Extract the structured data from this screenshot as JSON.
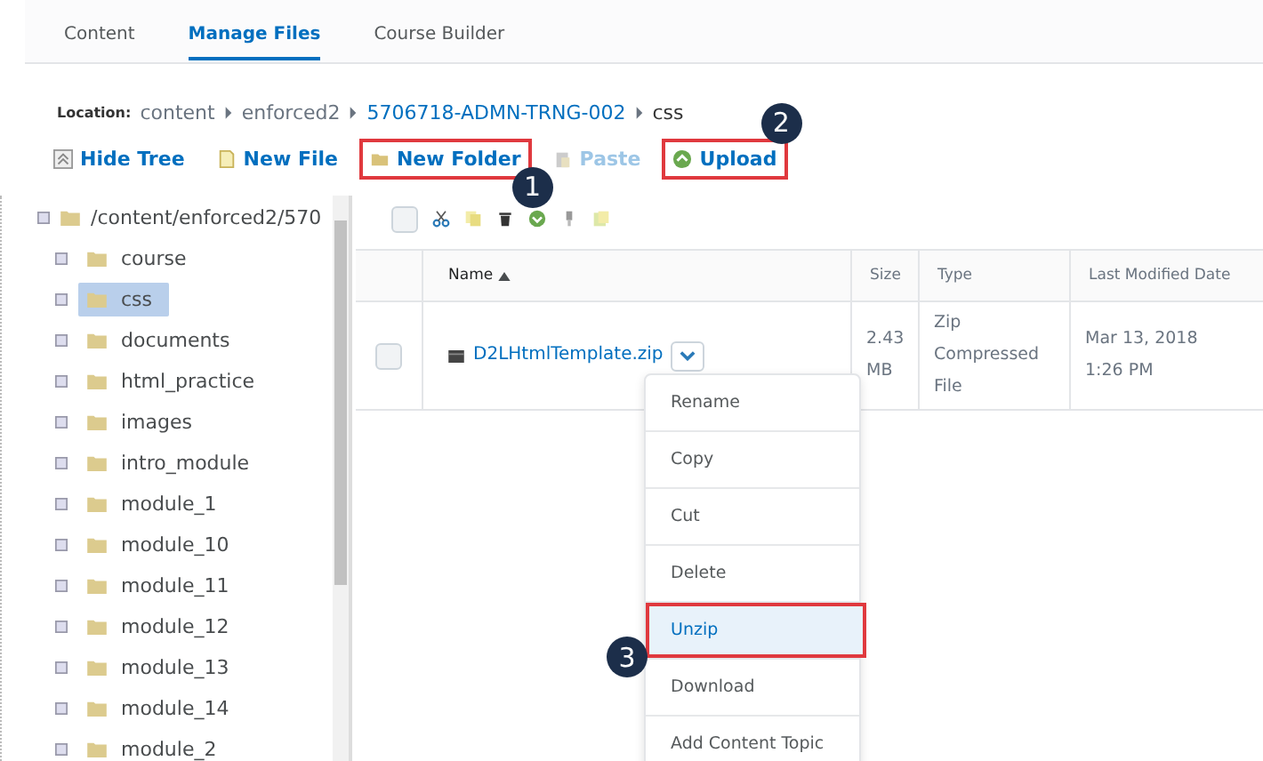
{
  "tabs": [
    {
      "label": "Content",
      "selected": false
    },
    {
      "label": "Manage Files",
      "selected": true
    },
    {
      "label": "Course Builder",
      "selected": false
    }
  ],
  "location": {
    "label": "Location:",
    "crumbs": [
      {
        "text": "content",
        "kind": "plain"
      },
      {
        "text": "enforced2",
        "kind": "plain"
      },
      {
        "text": "5706718-ADMN-TRNG-002",
        "kind": "link"
      },
      {
        "text": "css",
        "kind": "current"
      }
    ]
  },
  "toolbar": [
    {
      "label": "Hide Tree",
      "kind": "hide-tree",
      "disabled": false,
      "highlighted": false
    },
    {
      "label": "New File",
      "kind": "new-file",
      "disabled": false,
      "highlighted": false
    },
    {
      "label": "New Folder",
      "kind": "new-folder",
      "disabled": false,
      "highlighted": true,
      "callout": "1"
    },
    {
      "label": "Paste",
      "kind": "paste",
      "disabled": true,
      "highlighted": false
    },
    {
      "label": "Upload",
      "kind": "upload",
      "disabled": false,
      "highlighted": true,
      "callout": "2"
    }
  ],
  "tree": {
    "root": "/content/enforced2/570",
    "children": [
      {
        "label": "course",
        "selected": false
      },
      {
        "label": "css",
        "selected": true
      },
      {
        "label": "documents",
        "selected": false
      },
      {
        "label": "html_practice",
        "selected": false
      },
      {
        "label": "images",
        "selected": false
      },
      {
        "label": "intro_module",
        "selected": false
      },
      {
        "label": "module_1",
        "selected": false
      },
      {
        "label": "module_10",
        "selected": false
      },
      {
        "label": "module_11",
        "selected": false
      },
      {
        "label": "module_12",
        "selected": false
      },
      {
        "label": "module_13",
        "selected": false
      },
      {
        "label": "module_14",
        "selected": false
      },
      {
        "label": "module_2",
        "selected": false
      }
    ]
  },
  "table": {
    "select_all_checked": false,
    "columns": [
      {
        "label": "Name",
        "sorted": true
      },
      {
        "label": "Size",
        "sorted": false
      },
      {
        "label": "Type",
        "sorted": false
      },
      {
        "label": "Last Modified Date",
        "sorted": false
      }
    ],
    "rows": [
      {
        "name": "D2LHtmlTemplate.zip",
        "size": "2.43 MB",
        "type": "Zip Compressed File",
        "modified": "Mar 13, 2018 1:26 PM",
        "checked": false
      }
    ]
  },
  "menu": {
    "items": [
      {
        "label": "Rename",
        "highlighted": false
      },
      {
        "label": "Copy",
        "highlighted": false
      },
      {
        "label": "Cut",
        "highlighted": false
      },
      {
        "label": "Delete",
        "highlighted": false
      },
      {
        "label": "Unzip",
        "highlighted": true,
        "callout": "3"
      },
      {
        "label": "Download",
        "highlighted": false
      },
      {
        "label": "Add Content Topic",
        "highlighted": false
      }
    ]
  }
}
